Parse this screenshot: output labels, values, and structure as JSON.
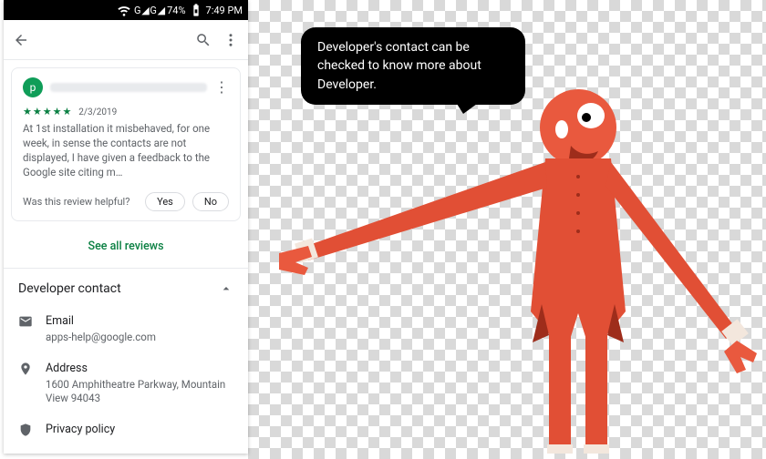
{
  "statusbar": {
    "net": "G ◢ G ◢",
    "battery": "74%",
    "time": "7:49 PM"
  },
  "review": {
    "avatar_letter": "p",
    "date": "2/3/2019",
    "text": "At 1st installation it misbehaved, for one week, in sense the contacts are not displayed, I have given a feedback to the Google site citing m…",
    "helpful_q": "Was this review helpful?",
    "yes": "Yes",
    "no": "No"
  },
  "see_all": "See all reviews",
  "dev": {
    "header": "Developer contact",
    "email_label": "Email",
    "email_value": "apps-help@google.com",
    "address_label": "Address",
    "address_value": "1600 Amphitheatre Parkway, Mountain View 94043",
    "privacy": "Privacy policy"
  },
  "callout": "Developer's contact can be checked to know more about Developer."
}
